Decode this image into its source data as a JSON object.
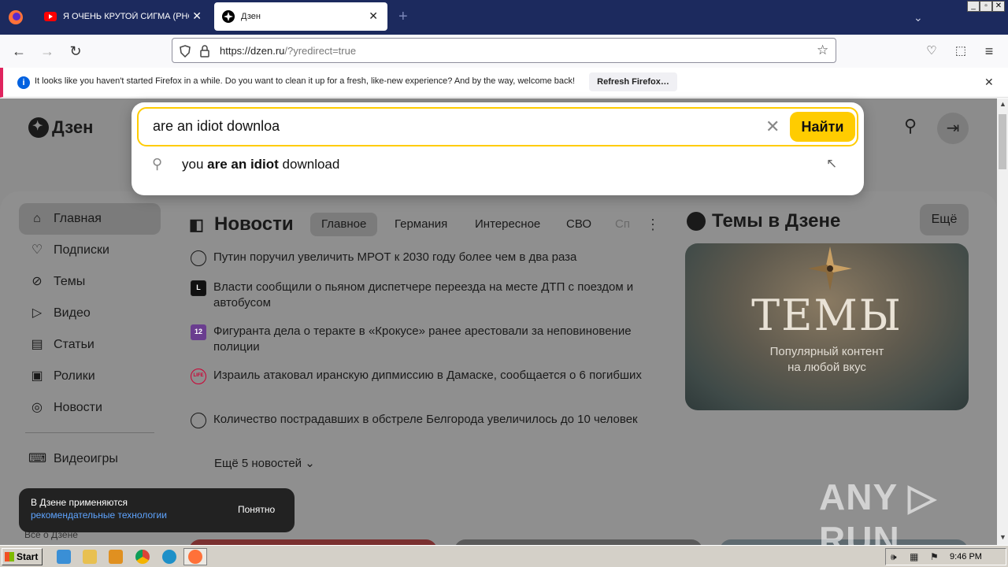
{
  "browser": {
    "tabs": [
      {
        "title": "Я ОЧЕНЬ КРУТОЙ СИГМА (PHONK",
        "icon": "youtube-icon"
      },
      {
        "title": "Дзен",
        "icon": "dzen-icon"
      }
    ],
    "url_host": "https://dzen.ru",
    "url_rest": "/?yredirect=true"
  },
  "notification": {
    "text": "It looks like you haven't started Firefox in a while. Do you want to clean it up for a fresh, like-new experience? And by the way, welcome back!",
    "button": "Refresh Firefox…"
  },
  "header": {
    "logo": "Дзен"
  },
  "search": {
    "value": "are an idiot downloa",
    "submit": "Найти",
    "suggestion_prefix": "you ",
    "suggestion_bold": "are an idiot",
    "suggestion_suffix": " download"
  },
  "sidebar": {
    "items": [
      {
        "label": "Главная",
        "icon": "home-icon"
      },
      {
        "label": "Подписки",
        "icon": "subscriptions-icon"
      },
      {
        "label": "Темы",
        "icon": "compass-icon"
      },
      {
        "label": "Видео",
        "icon": "play-icon"
      },
      {
        "label": "Статьи",
        "icon": "book-icon"
      },
      {
        "label": "Ролики",
        "icon": "shorts-icon"
      },
      {
        "label": "Новости",
        "icon": "news-icon"
      },
      {
        "label": "Видеоигры",
        "icon": "gamepad-icon"
      }
    ],
    "all_about": "Все о Дзене"
  },
  "news": {
    "title": "Новости",
    "tabs": [
      "Главное",
      "Германия",
      "Интересное",
      "СВО",
      "Сп"
    ],
    "items": [
      {
        "src": "",
        "text": "Путин поручил увеличить МРОТ к 2030 году более чем в два раза"
      },
      {
        "src": "L",
        "text": "Власти сообщили о пьяном диспетчере переезда на месте ДТП с поездом и автобусом"
      },
      {
        "src": "12",
        "text": "Фигуранта дела о теракте в «Крокусе» ранее арестовали за неповиновение полиции"
      },
      {
        "src": "LIFE",
        "text": "Израиль атаковал иранскую дипмиссию в Дамаске, сообщается о 6 погибших"
      },
      {
        "src": "",
        "text": "Количество пострадавших в обстреле Белгорода увеличилось до 10 человек"
      }
    ],
    "more": "Ещё 5 новостей"
  },
  "themes": {
    "title": "Темы в Дзене",
    "more": "Ещё",
    "card_title": "ТЕМЫ",
    "card_subtitle_1": "Популярный контент",
    "card_subtitle_2": "на любой вкус"
  },
  "toast": {
    "line1": "В Дзене применяются",
    "link": "рекомендательные технологии",
    "button": "Понятно"
  },
  "watermark": "ANY ▷ RUN",
  "taskbar": {
    "start": "Start",
    "clock": "9:46 PM"
  },
  "colors": {
    "accent": "#ffcc00",
    "tabbar": "#1c2a5e",
    "overlay": "#8c8c8c"
  }
}
